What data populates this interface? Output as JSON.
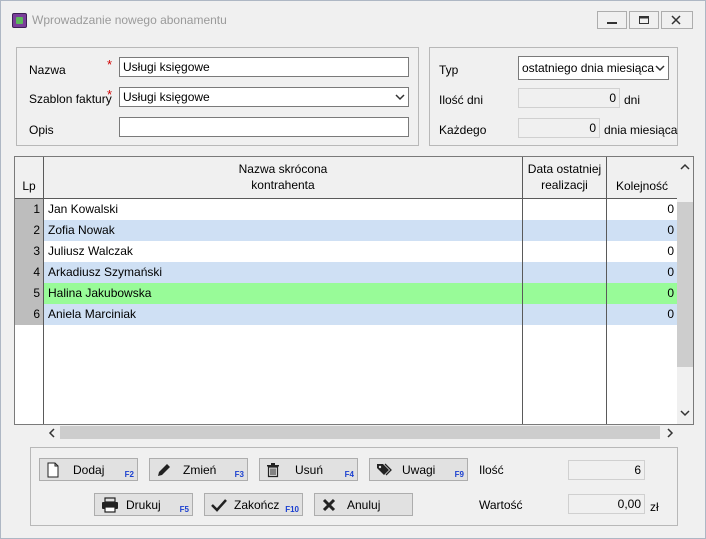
{
  "window": {
    "title": "Wprowadzanie nowego abonamentu",
    "icon": "app-icon",
    "controls": [
      "minimize-icon",
      "restore-icon",
      "close-icon"
    ]
  },
  "form": {
    "nazwa_label": "Nazwa",
    "nazwa_value": "Usługi księgowe",
    "szablon_label": "Szablon faktury",
    "szablon_value": "Usługi księgowe",
    "opis_label": "Opis",
    "opis_value": "",
    "required_mark": "*"
  },
  "typ_panel": {
    "typ_label": "Typ",
    "typ_value": "ostatniego dnia miesiąca",
    "ilosc_dni_label": "Ilość dni",
    "ilosc_dni_value": "0",
    "ilosc_dni_unit": "dni",
    "kazdego_label": "Każdego",
    "kazdego_value": "0",
    "kazdego_unit": "dnia miesiąca"
  },
  "grid": {
    "columns": [
      "Lp",
      "Nazwa skrócona\nkontrahenta",
      "Data ostatniej\nrealizacji",
      "Kolejność"
    ],
    "rows": [
      {
        "lp": "1",
        "name": "Jan Kowalski",
        "date": "",
        "order": "0",
        "bg": "#ffffff"
      },
      {
        "lp": "2",
        "name": "Zofia Nowak",
        "date": "",
        "order": "0",
        "bg": "#cfe0f4"
      },
      {
        "lp": "3",
        "name": "Juliusz Walczak",
        "date": "",
        "order": "0",
        "bg": "#ffffff"
      },
      {
        "lp": "4",
        "name": "Arkadiusz Szymański",
        "date": "",
        "order": "0",
        "bg": "#cfe0f4"
      },
      {
        "lp": "5",
        "name": "Halina Jakubowska",
        "date": "",
        "order": "0",
        "bg": "#98fb98"
      },
      {
        "lp": "6",
        "name": "Aniela Marciniak",
        "date": "",
        "order": "0",
        "bg": "#cfe0f4"
      }
    ]
  },
  "buttons": {
    "dodaj": {
      "label": "Dodaj",
      "key": "F2"
    },
    "zmien": {
      "label": "Zmień",
      "key": "F3"
    },
    "usun": {
      "label": "Usuń",
      "key": "F4"
    },
    "uwagi": {
      "label": "Uwagi",
      "key": "F9"
    },
    "drukuj": {
      "label": "Drukuj",
      "key": "F5"
    },
    "zakoncz": {
      "label": "Zakończ",
      "key": "F10"
    },
    "anuluj": {
      "label": "Anuluj",
      "key": ""
    }
  },
  "summary": {
    "ilosc_label": "Ilość",
    "ilosc_value": "6",
    "wartosc_label": "Wartość",
    "wartosc_value": "0,00",
    "wartosc_unit": "zł"
  }
}
